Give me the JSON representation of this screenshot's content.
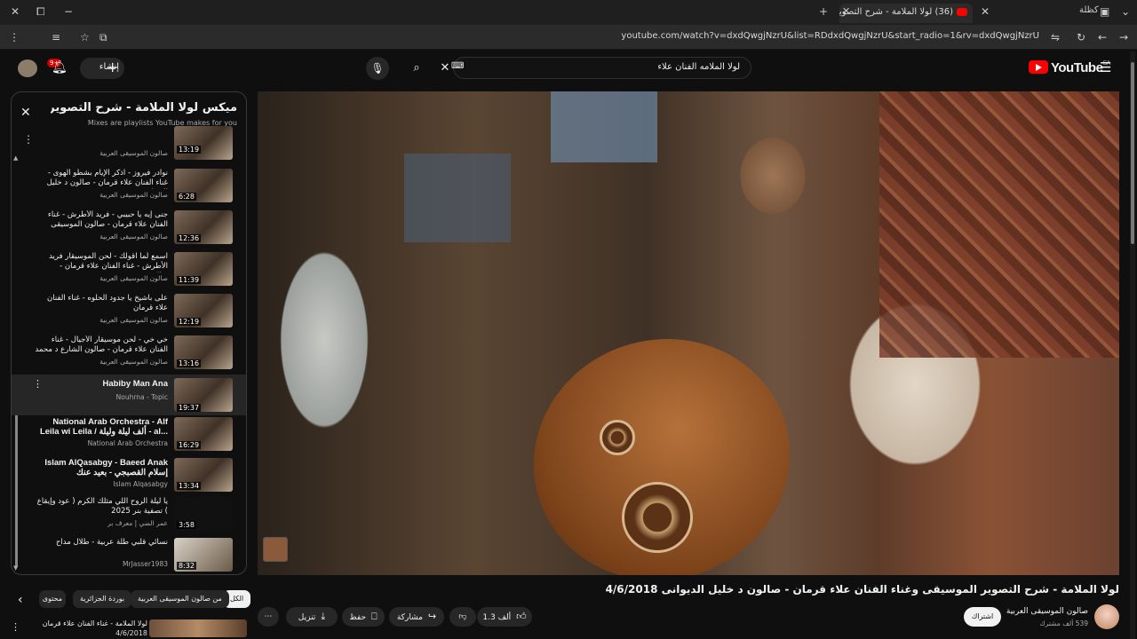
{
  "browser": {
    "tab_title": "(36) لولا الملامة - شرح التصوير",
    "profile_label": "كظلة",
    "url": "youtube.com/watch?v=dxdQwgjNzrU&list=RDdxdQwgjNzrU&start_radio=1&rv=dxdQwgjNzrU"
  },
  "youtube": {
    "logo_text": "YouTube",
    "logo_country": "SA",
    "search_value": "لولا الملامه الفنان علاء",
    "search_shortcut": "⌨",
    "create_label": "إنشاء",
    "notif_count": "9+"
  },
  "playlist": {
    "title": "ميكس لولا الملامة - شرح التصوير...",
    "subtitle": "Mixes are playlists YouTube makes for you",
    "top_partial_channel": "صالون الموسيقى العربية",
    "top_partial_duration": "13:19",
    "items": [
      {
        "title": "نوادر فيروز - اذكر الإيام بشطو الهوى - غناء الفنان علاء قرمان - صالون د خليل الديواني",
        "channel": "صالون الموسيقى العربية",
        "duration": "6:28"
      },
      {
        "title": "جنى إيه يا حبيبي - فريد الأطرش - غناء الفنان علاء قرمان - صالون الموسيقى",
        "channel": "صالون الموسيقى العربية",
        "duration": "12:36"
      },
      {
        "title": "اسمع لما اقولك - لحن الموسيقار فريد الأطرش - غناء الفنان علاء قرمان - صالون...",
        "channel": "صالون الموسيقى العربية",
        "duration": "11:39"
      },
      {
        "title": "على باشيخ يا جدود الحلوه - غناء الفنان علاء قرمان",
        "channel": "صالون الموسيقى العربية",
        "duration": "12:19"
      },
      {
        "title": "خي خي - لحن موسيقار الأجيال - غناء الفنان علاء قرمان - صالون الشارع د محمد محمد",
        "channel": "صالون الموسيقى العربية",
        "duration": "13:16"
      },
      {
        "title": "Habiby Man Ana",
        "channel": "Nouhrna - Topic",
        "duration": "19:37"
      },
      {
        "title": "National Arab Orchestra - Alf Leila wi Leila / ألف ليلة وليلة - al...",
        "channel": "National Arab Orchestra",
        "duration": "16:29"
      },
      {
        "title": "Islam AlQasabgy - Baeed Anak إسلام القصبجي - بعيد عنك",
        "channel": "Islam Alqasabgy",
        "duration": "13:34"
      },
      {
        "title": "يا ليلة الروح اللي مثلك الكرم ( عود وإيقاع ) تصفية بنر 2025",
        "channel": "عمر الضي | معرف بر",
        "duration": "3:58"
      },
      {
        "title": "نسائي قلبي طلة عربية - طلال مداح",
        "channel": "MrJasser1983",
        "duration": "8:32"
      }
    ]
  },
  "video": {
    "title": "لولا الملامة - شرح التصوير الموسيقى وغناء الفنان علاء قرمان - صالون د خليل الديوانى 4/6/2018",
    "channel_name": "صالون الموسيقى العربية",
    "channel_subs": "539 ألف مشترك",
    "subscribe_label": "اشتراك",
    "like_count": "1.3 ألف",
    "share_label": "مشاركة",
    "save_label": "حفظ",
    "download_label": "تنزيل"
  },
  "chips": [
    "الكل",
    "من صالون الموسيقى العربية",
    "بوردة الجزائرية",
    "محتوى"
  ],
  "below": {
    "next_title": "لولا الملامة - غناء الفنان علاء قرمان -",
    "next_date": "4/6/2018"
  }
}
